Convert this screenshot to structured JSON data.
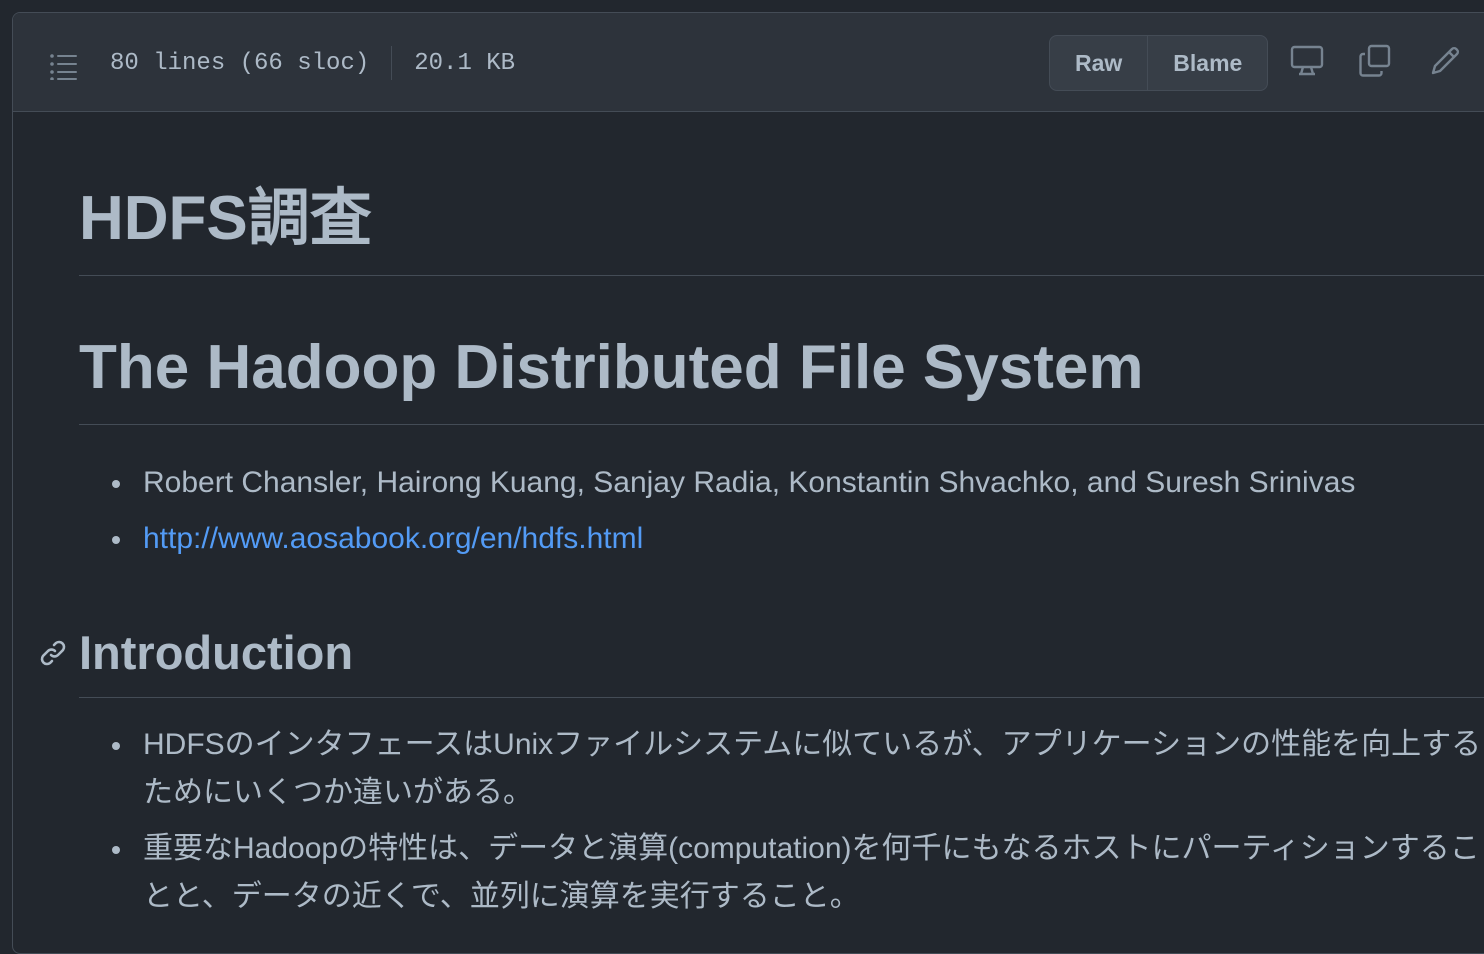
{
  "header": {
    "lines_info": "80 lines (66 sloc)",
    "size": "20.1 KB",
    "buttons": {
      "raw": "Raw",
      "blame": "Blame"
    },
    "icons": [
      "list-unordered-icon",
      "desktop-icon",
      "copy-icon",
      "pencil-icon"
    ]
  },
  "document": {
    "title": "HDFS調査",
    "subtitle": "The Hadoop Distributed File System",
    "meta_items": [
      "Robert Chansler, Hairong Kuang, Sanjay Radia, Konstantin Shvachko, and Suresh Srinivas",
      "http://www.aosabook.org/en/hdfs.html"
    ],
    "section": {
      "heading": "Introduction",
      "items": [
        "HDFSのインタフェースはUnixファイルシステムに似ているが、アプリケーションの性能を向上するためにいくつか違いがある。",
        "重要なHadoopの特性は、データと演算(computation)を何千にもなるホストにパーティションすることと、データの近くで、並列に演算を実行すること。"
      ]
    }
  },
  "colors": {
    "background": "#22272e",
    "header_bg": "#2d333b",
    "border": "#444c56",
    "text": "#adbac7",
    "link": "#539bf5"
  }
}
